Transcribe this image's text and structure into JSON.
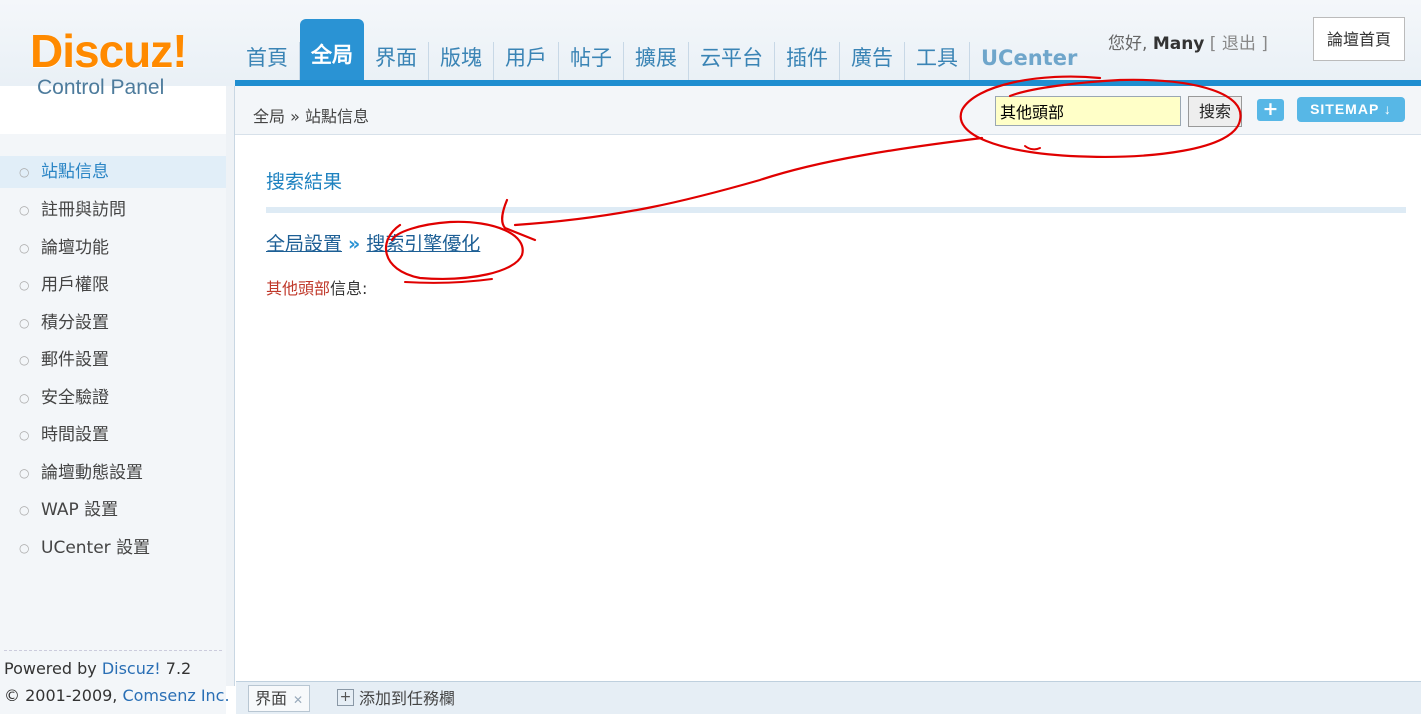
{
  "logo": {
    "brand": "Discuz!",
    "sub": "Control Panel"
  },
  "nav": {
    "items": [
      "首頁",
      "全局",
      "界面",
      "版塊",
      "用戶",
      "帖子",
      "擴展",
      "云平台",
      "插件",
      "廣告",
      "工具",
      "UCenter"
    ],
    "active": "全局"
  },
  "user": {
    "greeting": "您好,",
    "name": "Many",
    "logout": "退出",
    "bracket_open": "[",
    "bracket_close": "]"
  },
  "home_link": "論壇首頁",
  "breadcrumb": "全局 » 站點信息",
  "search": {
    "value": "其他頭部",
    "button": "搜索"
  },
  "buttons": {
    "plus": "+",
    "sitemap": "SITEMAP ↓"
  },
  "sidebar": {
    "items": [
      "站點信息",
      "註冊與訪問",
      "論壇功能",
      "用戶權限",
      "積分設置",
      "郵件設置",
      "安全驗證",
      "時間設置",
      "論壇動態設置",
      "WAP 設置",
      "UCenter 設置"
    ],
    "active_index": 0
  },
  "footer": {
    "powered_prefix": "Powered by ",
    "powered_link": "Discuz!",
    "version": " 7.2",
    "copyright_prefix": "© 2001-2009, ",
    "copyright_link": "Comsenz Inc."
  },
  "main": {
    "title": "搜索結果",
    "path": {
      "first": "全局設置",
      "sep": "»",
      "second": "搜索引擎優化"
    },
    "desc": {
      "highlight": "其他頭部",
      "rest": "信息:"
    }
  },
  "taskbar": {
    "tab_label": "界面",
    "tab_close": "✕",
    "add_label": "添加到任務欄",
    "add_icon": "+"
  },
  "colors": {
    "accent": "#2a93d4",
    "logo": "#ff8a00",
    "annotation": "#e00000",
    "search_bg": "#ffffc8"
  }
}
